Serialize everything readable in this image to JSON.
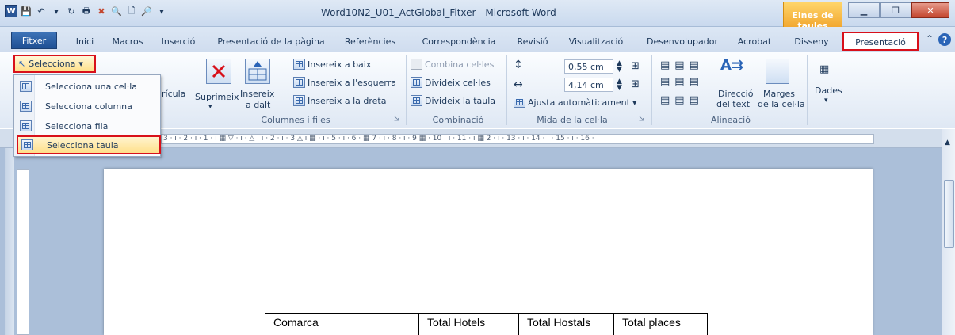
{
  "window": {
    "title": "Word10N2_U01_ActGlobal_Fitxer - Microsoft Word",
    "contextual_group": "Eines de taules"
  },
  "tabs": [
    {
      "label": "Fitxer"
    },
    {
      "label": "Inici"
    },
    {
      "label": "Macros"
    },
    {
      "label": "Inserció"
    },
    {
      "label": "Presentació de la pàgina"
    },
    {
      "label": "Referències"
    },
    {
      "label": "Correspondència"
    },
    {
      "label": "Revisió"
    },
    {
      "label": "Visualització"
    },
    {
      "label": "Desenvolupador"
    },
    {
      "label": "Acrobat"
    },
    {
      "label": "Disseny"
    },
    {
      "label": "Presentació"
    }
  ],
  "ribbon": {
    "selecciona_label": "Selecciona",
    "quadricula_fragment": "rícula",
    "suprimeix": "Suprimeix",
    "insereix_a_dalt_1": "Insereix",
    "insereix_a_dalt_2": "a dalt",
    "insereix_a_baix": "Insereix a baix",
    "insereix_esquerra": "Insereix a l'esquerra",
    "insereix_dreta": "Insereix a la dreta",
    "combina_cel_les": "Combina cel·les",
    "divideix_cel_les": "Divideix cel·les",
    "divideix_taula": "Divideix la taula",
    "height_value": "0,55 cm",
    "width_value": "4,14 cm",
    "ajusta": "Ajusta automàticament",
    "direccio_1": "Direcció",
    "direccio_2": "del text",
    "marges_1": "Marges",
    "marges_2": "de la cel·la",
    "dades": "Dades",
    "groups": {
      "columnes_files": "Columnes i files",
      "combinacio": "Combinació",
      "mida": "Mida de la cel·la",
      "alineacio": "Alineació"
    }
  },
  "menu": {
    "items": [
      {
        "label": "Selecciona una cel·la"
      },
      {
        "label": "Selecciona columna"
      },
      {
        "label": "Selecciona fila"
      },
      {
        "label": "Selecciona taula"
      }
    ]
  },
  "ruler": {
    "text": "3 · ı · 2 · ı · 1 · ı ▦ ▽ · ı · △ · ı · 2 · ı · 3 △ ı ▦ · ı · 5 · ı · 6 · ▦ 7 · ı · 8 · ı · 9 ▦ · 10 · ı · 11 · ı ▦ 2 · ı · 13 · ı · 14 · ı · 15 · ı · 16 ·"
  },
  "document": {
    "table_headers": [
      "Comarca",
      "Total Hotels",
      "Total Hostals",
      "Total places"
    ]
  },
  "colors": {
    "highlight_border": "#d8101a",
    "contextual_tab": "#f2a831",
    "file_tab": "#2b5797"
  }
}
